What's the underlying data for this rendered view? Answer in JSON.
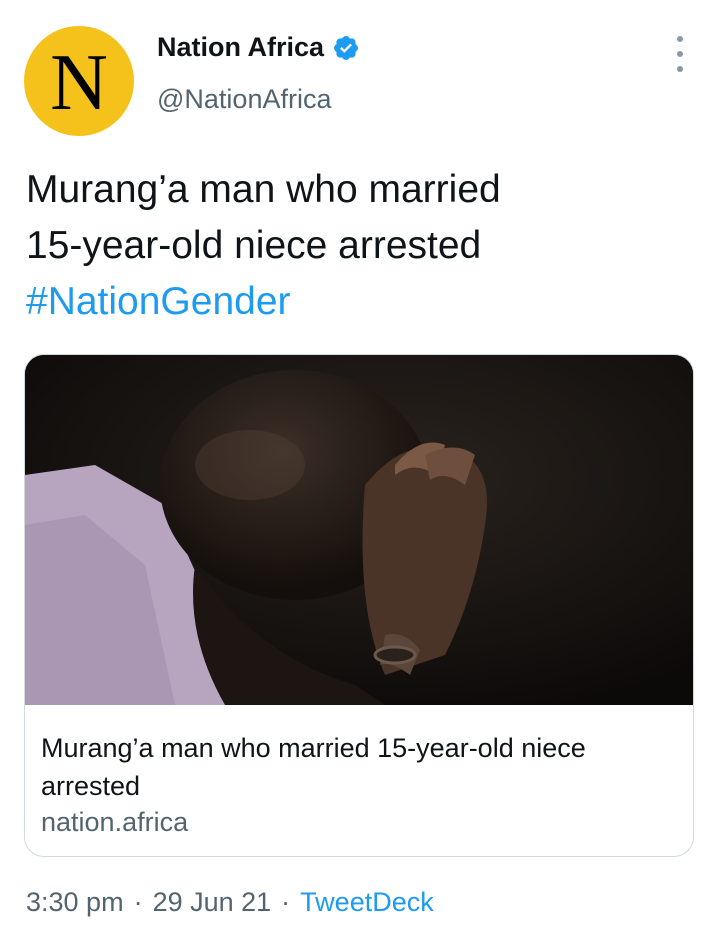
{
  "author": {
    "avatar_letter": "N",
    "display_name": "Nation Africa",
    "handle": "@NationAfrica",
    "avatar_color": "#f5c21b",
    "verified_icon": "verified-badge-icon"
  },
  "tweet": {
    "text_line1": "Murang’a man who married",
    "text_line2": "15-year-old niece arrested",
    "hashtag": "#NationGender"
  },
  "link_card": {
    "title": "Murang’a man who married 15-year-old niece arrested",
    "domain": "nation.africa"
  },
  "meta": {
    "time": "3:30 pm",
    "separator": "·",
    "date": "29 Jun 21",
    "source": "TweetDeck"
  },
  "colors": {
    "accent": "#1d9bf0",
    "secondary_text": "#536471",
    "border": "#cfd9de"
  }
}
